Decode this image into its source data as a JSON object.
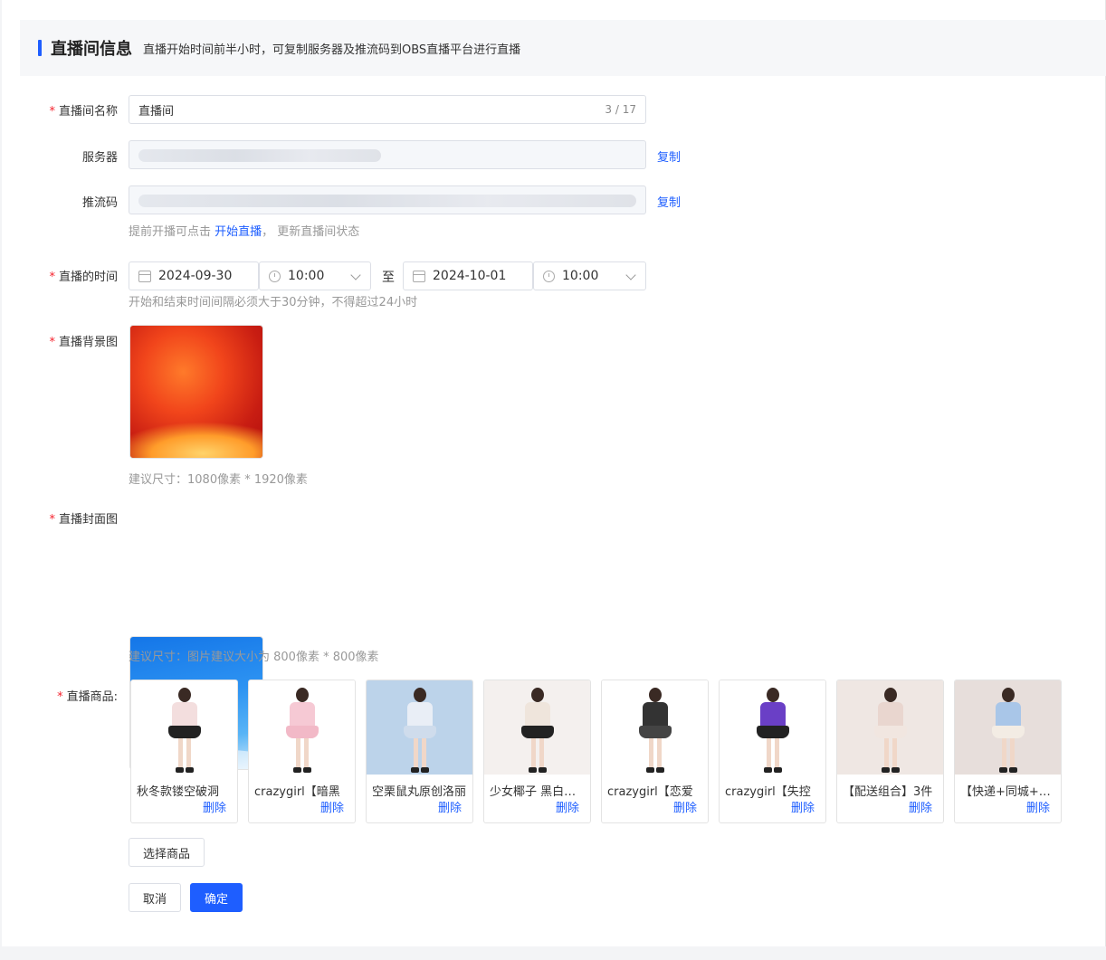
{
  "header": {
    "title": "直播间信息",
    "desc": "直播开始时间前半小时，可复制服务器及推流码到OBS直播平台进行直播"
  },
  "form": {
    "name": {
      "label": "直播间名称",
      "value": "直播间",
      "counter": "3 / 17"
    },
    "server": {
      "label": "服务器",
      "copy": "复制"
    },
    "stream_key": {
      "label": "推流码",
      "copy": "复制"
    },
    "hint": {
      "before": "提前开播可点击",
      "link": "开始直播",
      "after": "， 更新直播间状态"
    },
    "time": {
      "label": "直播的时间",
      "start_date": "2024-09-30",
      "start_time": "10:00",
      "sep": "至",
      "end_date": "2024-10-01",
      "end_time": "10:00",
      "hint": "开始和结束时间间隔必须大于30分钟，不得超过24小时"
    },
    "background": {
      "label": "直播背景图",
      "hint": "建议尺寸：1080像素 * 1920像素"
    },
    "cover": {
      "label": "直播封面图",
      "hint": "建议尺寸：图片建议大小为 800像素 * 800像素"
    },
    "goods": {
      "label": "直播商品:",
      "delete_label": "删除",
      "items": [
        {
          "name": "秋冬款镂空破洞",
          "top": "#f3dede",
          "skirt": "#222",
          "bg": "#ffffff"
        },
        {
          "name": "crazygirl【暗黑",
          "top": "#f6c9d4",
          "skirt": "#f2b9c7",
          "bg": "#ffffff"
        },
        {
          "name": "空栗鼠丸原创洛丽",
          "top": "#e9eef6",
          "skirt": "#cfdcec",
          "bg": "#bcd3ea"
        },
        {
          "name": "少女椰子 黑白拼色",
          "top": "#efe5dc",
          "skirt": "#222",
          "bg": "#f4f0ee"
        },
        {
          "name": "crazygirl【恋爱",
          "top": "#333",
          "skirt": "#444",
          "bg": "#ffffff"
        },
        {
          "name": "crazygirl【失控",
          "top": "#6a3fc6",
          "skirt": "#222",
          "bg": "#ffffff"
        },
        {
          "name": "【配送组合】3件",
          "top": "#e9d6cf",
          "skirt": "#f1e6e0",
          "bg": "#efe7e3"
        },
        {
          "name": "【快递+同城+自提",
          "top": "#a9c6e8",
          "skirt": "#f3ece4",
          "bg": "#e7dedb"
        }
      ]
    },
    "select_goods": "选择商品",
    "cancel": "取消",
    "confirm": "确定"
  }
}
